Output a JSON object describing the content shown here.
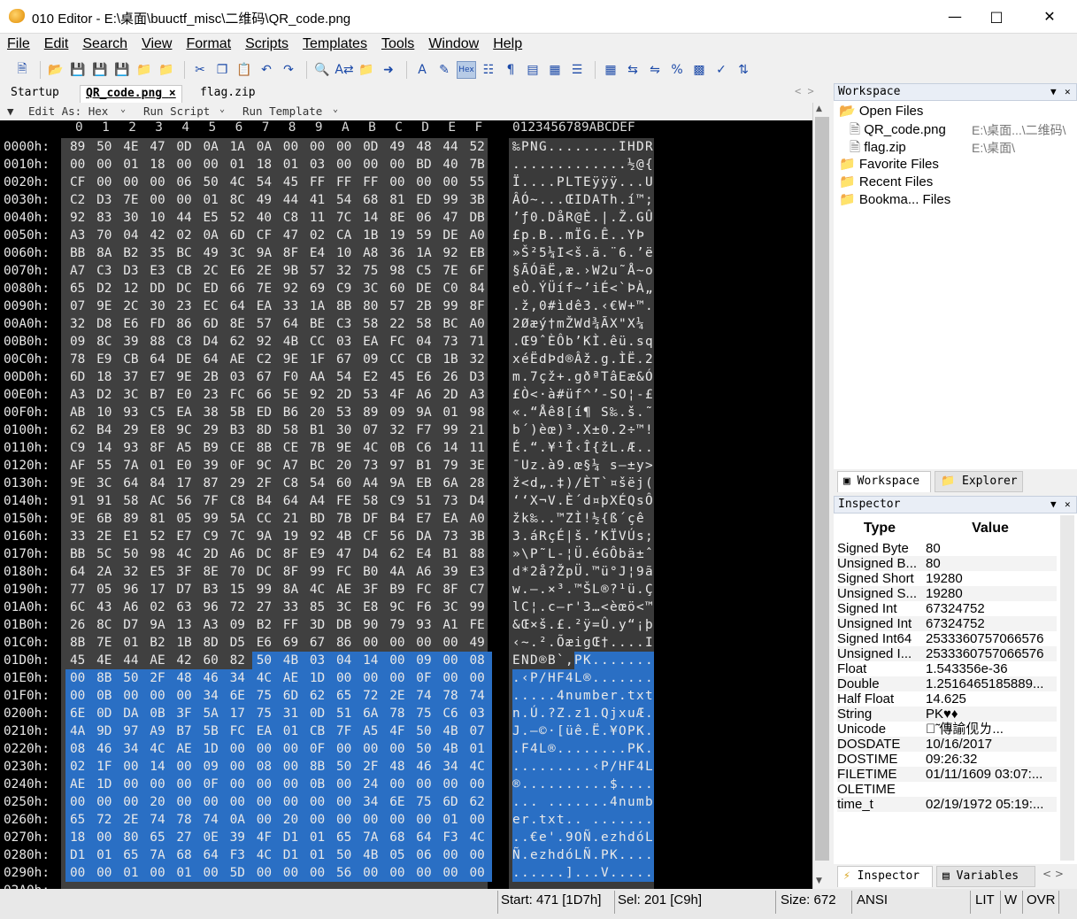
{
  "window": {
    "title": "010 Editor - E:\\桌面\\buuctf_misc\\二维码\\QR_code.png"
  },
  "menu": [
    "File",
    "Edit",
    "Search",
    "View",
    "Format",
    "Scripts",
    "Templates",
    "Tools",
    "Window",
    "Help"
  ],
  "tabs": {
    "startup": "Startup",
    "active": "QR_code.png",
    "other": "flag.zip",
    "close": "×"
  },
  "subbar": {
    "edit_as": "Edit As: Hex",
    "run_script": "Run Script",
    "run_template": "Run Template"
  },
  "hex": {
    "columns": [
      "0",
      "1",
      "2",
      "3",
      "4",
      "5",
      "6",
      "7",
      "8",
      "9",
      "A",
      "B",
      "C",
      "D",
      "E",
      "F"
    ],
    "ascii_header": "0123456789ABCDEF",
    "rows": [
      {
        "a": "0000h:",
        "h": "89 50 4E 47 0D 0A 1A 0A 00 00 00 0D 49 48 44 52",
        "s": "‰PNG........IHDR"
      },
      {
        "a": "0010h:",
        "h": "00 00 01 18 00 00 01 18 01 03 00 00 00 BD 40 7B",
        "s": ".............½@{"
      },
      {
        "a": "0020h:",
        "h": "CF 00 00 00 06 50 4C 54 45 FF FF FF 00 00 00 55",
        "s": "Ï....PLTEÿÿÿ...U"
      },
      {
        "a": "0030h:",
        "h": "C2 D3 7E 00 00 01 8C 49 44 41 54 68 81 ED 99 3B",
        "s": "ÂÓ~...ŒIDATh.í™;"
      },
      {
        "a": "0040h:",
        "h": "92 83 30 10 44 E5 52 40 C8 11 7C 14 8E 06 47 DB",
        "s": "’ƒ0.DåR@È.|.Ž.GÛ"
      },
      {
        "a": "0050h:",
        "h": "A3 70 04 42 02 0A 6D CF 47 02 CA 1B 19 59 DE A0",
        "s": "£p.B..mÏG.Ê..YÞ "
      },
      {
        "a": "0060h:",
        "h": "BB 8A B2 35 BC 49 3C 9A 8F E4 10 A8 36 1A 92 EB",
        "s": "»Š²5¼I<š.ä.¨6.’ë"
      },
      {
        "a": "0070h:",
        "h": "A7 C3 D3 E3 CB 2C E6 2E 9B 57 32 75 98 C5 7E 6F",
        "s": "§ÃÓãË,æ.›W2u˜Å~o"
      },
      {
        "a": "0080h:",
        "h": "65 D2 12 DD DC ED 66 7E 92 69 C9 3C 60 DE C0 84",
        "s": "eÒ.ÝÜíf~’iÉ<`ÞÀ„"
      },
      {
        "a": "0090h:",
        "h": "07 9E 2C 30 23 EC 64 EA 33 1A 8B 80 57 2B 99 8F",
        "s": ".ž,0#ìdê3.‹€W+™."
      },
      {
        "a": "00A0h:",
        "h": "32 D8 E6 FD 86 6D 8E 57 64 BE C3 58 22 58 BC A0",
        "s": "2Øæý†mŽWd¾ÃX\"X¼ "
      },
      {
        "a": "00B0h:",
        "h": "09 8C 39 88 C8 D4 62 92 4B CC 03 EA FC 04 73 71",
        "s": ".Œ9ˆÈÔb’KÌ.êü.sq"
      },
      {
        "a": "00C0h:",
        "h": "78 E9 CB 64 DE 64 AE C2 9E 1F 67 09 CC CB 1B 32",
        "s": "xéËdÞd®Âž.g.ÌË.2"
      },
      {
        "a": "00D0h:",
        "h": "6D 18 37 E7 9E 2B 03 67 F0 AA 54 E2 45 E6 26 D3",
        "s": "m.7çž+.gðªTâEæ&Ó"
      },
      {
        "a": "00E0h:",
        "h": "A3 D2 3C B7 E0 23 FC 66 5E 92 2D 53 4F A6 2D A3",
        "s": "£Ò<·à#üf^’-SO¦-£"
      },
      {
        "a": "00F0h:",
        "h": "AB 10 93 C5 EA 38 5B ED B6 20 53 89 09 9A 01 98",
        "s": "«.“Åê8[í¶ S‰.š.˜"
      },
      {
        "a": "0100h:",
        "h": "62 B4 29 E8 9C 29 B3 8D 58 B1 30 07 32 F7 99 21",
        "s": "b´)èœ)³.X±0.2÷™!"
      },
      {
        "a": "0110h:",
        "h": "C9 14 93 8F A5 B9 CE 8B CE 7B 9E 4C 0B C6 14 11",
        "s": "É.“.¥¹Î‹Î{žL.Æ.."
      },
      {
        "a": "0120h:",
        "h": "AF 55 7A 01 E0 39 0F 9C A7 BC 20 73 97 B1 79 3E",
        "s": "¯Uz.à9.œ§¼ s—±y>"
      },
      {
        "a": "0130h:",
        "h": "9E 3C 64 84 17 87 29 2F C8 54 60 A4 9A EB 6A 28",
        "s": "ž<d„.‡)/ÈT`¤šëj("
      },
      {
        "a": "0140h:",
        "h": "91 91 58 AC 56 7F C8 B4 64 A4 FE 58 C9 51 73 D4",
        "s": "‘‘X¬V.È´d¤þXÉQsÔ"
      },
      {
        "a": "0150h:",
        "h": "9E 6B 89 81 05 99 5A CC 21 BD 7B DF B4 E7 EA A0",
        "s": "žk‰..™ZÌ!½{ß´çê "
      },
      {
        "a": "0160h:",
        "h": "33 2E E1 52 E7 C9 7C 9A 19 92 4B CF 56 DA 73 3B",
        "s": "3.áRçÉ|š.’KÏVÚs;"
      },
      {
        "a": "0170h:",
        "h": "BB 5C 50 98 4C 2D A6 DC 8F E9 47 D4 62 E4 B1 88",
        "s": "»\\P˜L-¦Ü.éGÔbä±ˆ"
      },
      {
        "a": "0180h:",
        "h": "64 2A 32 E5 3F 8E 70 DC 8F 99 FC B0 4A A6 39 E3",
        "s": "d*2å?ŽpÜ.™ü°J¦9ã"
      },
      {
        "a": "0190h:",
        "h": "77 05 96 17 D7 B3 15 99 8A 4C AE 3F B9 FC 8F C7",
        "s": "w.–.×³.™ŠL®?¹ü.Ç"
      },
      {
        "a": "01A0h:",
        "h": "6C 43 A6 02 63 96 72 27 33 85 3C E8 9C F6 3C 99",
        "s": "lC¦.c–r'3…<èœö<™"
      },
      {
        "a": "01B0h:",
        "h": "26 8C D7 9A 13 A3 09 B2 FF 3D DB 90 79 93 A1 FE",
        "s": "&Œ×š.£.²ÿ=Û.y“¡þ"
      },
      {
        "a": "01C0h:",
        "h": "8B 7E 01 B2 1B 8D D5 E6 69 67 86 00 00 00 00 49",
        "s": "‹~.².ÕæigŒ†....I"
      },
      {
        "a": "01D0h:",
        "h": "45 4E 44 AE 42 60 82 50 4B 03 04 14 00 09 00 08",
        "s": "END®B`‚PK......."
      },
      {
        "a": "01E0h:",
        "h": "00 8B 50 2F 48 46 34 4C AE 1D 00 00 00 0F 00 00",
        "s": ".‹P/HF4L®......."
      },
      {
        "a": "01F0h:",
        "h": "00 0B 00 00 00 34 6E 75 6D 62 65 72 2E 74 78 74",
        "s": ".....4number.txt"
      },
      {
        "a": "0200h:",
        "h": "6E 0D DA 0B 3F 5A 17 75 31 0D 51 6A 78 75 C6 03",
        "s": "n.Ú.?Z.z1.QjxuÆ."
      },
      {
        "a": "0210h:",
        "h": "4A 9D 97 A9 B7 5B FC EA 01 CB 7F A5 4F 50 4B 07",
        "s": "J.—©·[üê.Ë.¥OPK."
      },
      {
        "a": "0220h:",
        "h": "08 46 34 4C AE 1D 00 00 00 0F 00 00 00 50 4B 01",
        "s": ".F4L®........PK."
      },
      {
        "a": "0230h:",
        "h": "02 1F 00 14 00 09 00 08 00 8B 50 2F 48 46 34 4C",
        "s": ".........‹P/HF4L"
      },
      {
        "a": "0240h:",
        "h": "AE 1D 00 00 00 0F 00 00 00 0B 00 24 00 00 00 00",
        "s": "®..........$...."
      },
      {
        "a": "0250h:",
        "h": "00 00 00 20 00 00 00 00 00 00 00 34 6E 75 6D 62",
        "s": "... .......4numb"
      },
      {
        "a": "0260h:",
        "h": "65 72 2E 74 78 74 0A 00 20 00 00 00 00 00 01 00",
        "s": "er.txt.. ......."
      },
      {
        "a": "0270h:",
        "h": "18 00 80 65 27 0E 39 4F D1 01 65 7A 68 64 F3 4C",
        "s": "..€e'.9OÑ.ezhdóL"
      },
      {
        "a": "0280h:",
        "h": "D1 01 65 7A 68 64 F3 4C D1 01 50 4B 05 06 00 00",
        "s": "Ñ.ezhdóLÑ.PK...."
      },
      {
        "a": "0290h:",
        "h": "00 00 01 00 01 00 5D 00 00 00 56 00 00 00 00 00",
        "s": "......]...V....."
      },
      {
        "a": "02A0h:",
        "h": "",
        "s": ""
      }
    ]
  },
  "workspace": {
    "title": "Workspace",
    "open_files": "Open Files",
    "files": [
      {
        "name": "QR_code.png",
        "path": "E:\\桌面...\\二维码\\"
      },
      {
        "name": "flag.zip",
        "path": "E:\\桌面\\"
      }
    ],
    "favorite": "Favorite Files",
    "recent": "Recent Files",
    "bookmarks": "Bookma... Files",
    "tab_workspace": "Workspace",
    "tab_explorer": "Explorer"
  },
  "inspector": {
    "title": "Inspector",
    "col_type": "Type",
    "col_value": "Value",
    "rows": [
      {
        "t": "Signed Byte",
        "v": "80"
      },
      {
        "t": "Unsigned B...",
        "v": "80"
      },
      {
        "t": "Signed Short",
        "v": "19280"
      },
      {
        "t": "Unsigned S...",
        "v": "19280"
      },
      {
        "t": "Signed Int",
        "v": "67324752"
      },
      {
        "t": "Unsigned Int",
        "v": "67324752"
      },
      {
        "t": "Signed Int64",
        "v": "2533360757066576"
      },
      {
        "t": "Unsigned I...",
        "v": "2533360757066576"
      },
      {
        "t": "Float",
        "v": "1.543356e-36"
      },
      {
        "t": "Double",
        "v": "1.2516465185889..."
      },
      {
        "t": "Half Float",
        "v": "14.625"
      },
      {
        "t": "String",
        "v": "PK♥♦"
      },
      {
        "t": "Unicode",
        "v": "䭐̃ 傳諭伣ㄌ..."
      },
      {
        "t": "DOSDATE",
        "v": "10/16/2017"
      },
      {
        "t": "DOSTIME",
        "v": "09:26:32"
      },
      {
        "t": "FILETIME",
        "v": "01/11/1609 03:07:..."
      },
      {
        "t": "OLETIME",
        "v": ""
      },
      {
        "t": "time_t",
        "v": "02/19/1972 05:19:..."
      }
    ],
    "tab_inspector": "Inspector",
    "tab_variables": "Variables"
  },
  "status": {
    "start": "Start: 471 [1D7h]",
    "sel": "Sel: 201 [C9h]",
    "size": "Size: 672",
    "enc": "ANSI",
    "lit": "LIT",
    "w": "W",
    "ovr": "OVR"
  },
  "selection": {
    "start": 471,
    "length": 201
  }
}
